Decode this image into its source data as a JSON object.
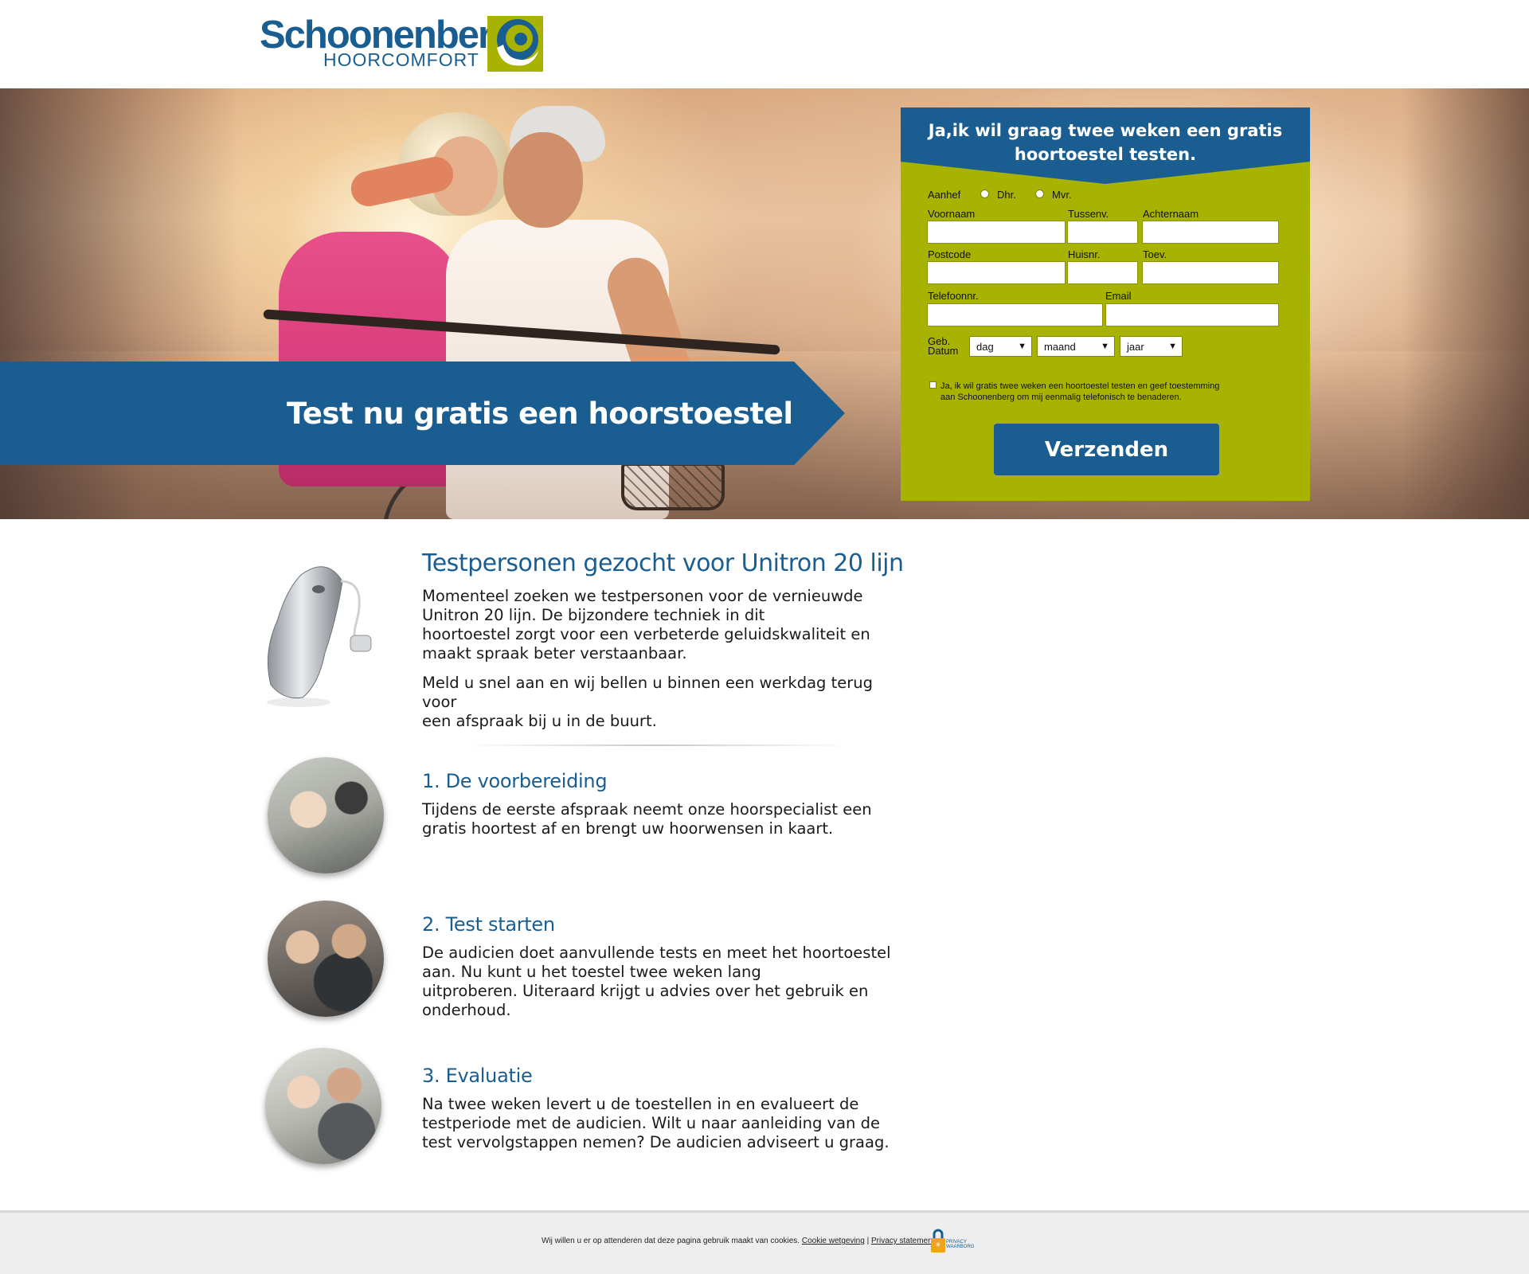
{
  "brand": {
    "name": "Schoonenberg",
    "subtitle": "HOORCOMFORT",
    "primary_color": "#1a5e91",
    "accent_color": "#a7b300"
  },
  "hero": {
    "banner_text": "Test nu gratis een hoorstoestel"
  },
  "form": {
    "heading": "Ja,ik wil graag twee weken een gratis hoortoestel testen.",
    "salutation_label": "Aanhef",
    "salutation_options": [
      "Dhr.",
      "Mvr."
    ],
    "first_name_label": "Voornaam",
    "infix_label": "Tussenv.",
    "last_name_label": "Achternaam",
    "postcode_label": "Postcode",
    "house_number_label": "Huisnr.",
    "addition_label": "Toev.",
    "phone_label": "Telefoonnr.",
    "email_label": "Email",
    "dob_label_line1": "Geb.",
    "dob_label_line2": "Datum",
    "day_select": "dag",
    "month_select": "maand",
    "year_select": "jaar",
    "consent_line1": "Ja, ik wil gratis twee weken een hoortoestel testen en geef toestemming",
    "consent_line2": "aan Schoonenberg om mij eenmalig telefonisch te benaderen.",
    "submit_label": "Verzenden"
  },
  "intro": {
    "title": "Testpersonen gezocht voor Unitron 20 lijn",
    "paragraph1_lines": [
      "Momenteel zoeken we testpersonen voor de vernieuwde",
      "Unitron 20 lijn. De bijzondere techniek in dit",
      "hoortoestel zorgt voor een verbeterde geluidskwaliteit en",
      "maakt spraak beter verstaanbaar."
    ],
    "paragraph2_lines": [
      "Meld u snel aan en wij bellen u binnen een werkdag terug voor",
      "een afspraak bij u in de buurt."
    ]
  },
  "steps": [
    {
      "title": "1. De voorbereiding",
      "lines": [
        "Tijdens de eerste afspraak neemt onze hoorspecialist een",
        "gratis hoortest af en brengt uw hoorwensen in kaart."
      ]
    },
    {
      "title": "2. Test starten",
      "lines": [
        "De audicien doet aanvullende tests en meet het hoortoestel",
        "aan. Nu kunt u het toestel twee weken lang",
        "uitproberen. Uiteraard krijgt u advies over het gebruik en",
        "onderhoud."
      ]
    },
    {
      "title": "3. Evaluatie",
      "lines": [
        "Na twee weken levert u de toestellen in en evalueert de",
        "testperiode met de audicien. Wilt u naar aanleiding van de",
        "test vervolgstappen nemen? De audicien adviseert u graag."
      ]
    }
  ],
  "footer": {
    "notice": "Wij willen u er op attenderen dat deze pagina gebruik maakt van cookies.",
    "cookie_link": "Cookie wetgeving",
    "separator": "|",
    "privacy_link": "Privacy statement",
    "badge_line1": "PRIVACY",
    "badge_line2": "WAARBORG"
  }
}
